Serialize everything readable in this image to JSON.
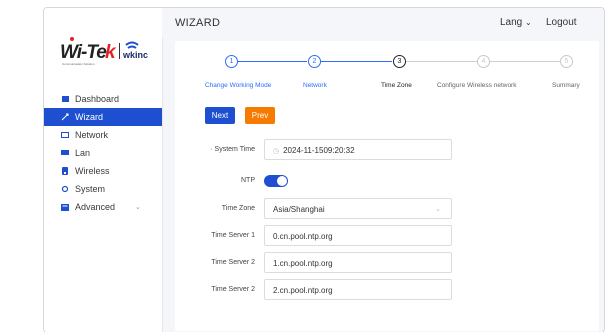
{
  "header": {
    "title": "WIZARD",
    "lang": "Lang",
    "logout": "Logout"
  },
  "brand": {
    "logo1": "Wi-Tek",
    "logo1_sub": "Communication Solution",
    "logo2": "wkinc"
  },
  "sidebar": {
    "items": [
      {
        "label": "Dashboard",
        "icon": "dashboard-icon"
      },
      {
        "label": "Wizard",
        "icon": "wizard-icon",
        "active": true
      },
      {
        "label": "Network",
        "icon": "network-icon"
      },
      {
        "label": "Lan",
        "icon": "lan-icon"
      },
      {
        "label": "Wireless",
        "icon": "wireless-icon"
      },
      {
        "label": "System",
        "icon": "system-icon"
      },
      {
        "label": "Advanced",
        "icon": "advanced-icon"
      }
    ]
  },
  "steps": [
    {
      "num": "1",
      "label": "Change Working Mode",
      "state": "done"
    },
    {
      "num": "2",
      "label": "Network",
      "state": "done"
    },
    {
      "num": "3",
      "label": "Time Zone",
      "state": "current"
    },
    {
      "num": "4",
      "label": "Configure Wireless network",
      "state": "todo"
    },
    {
      "num": "5",
      "label": "Summary",
      "state": "todo"
    }
  ],
  "buttons": {
    "next": "Next",
    "prev": "Prev"
  },
  "form": {
    "system_time_label": "System Time",
    "system_time_value": "2024-11-1509:20:32",
    "ntp_label": "NTP",
    "ntp_enabled": true,
    "time_zone_label": "Time Zone",
    "time_zone_value": "Asia/Shanghai",
    "server1_label": "Time Server 1",
    "server1_value": "0.cn.pool.ntp.org",
    "server2_label": "Time Server 2",
    "server2_value": "1.cn.pool.ntp.org",
    "server3_label": "Time Server 2",
    "server3_value": "2.cn.pool.ntp.org"
  },
  "colors": {
    "accent": "#1f4fd1",
    "step_blue": "#2f6bff",
    "prev_orange": "#f57c00"
  }
}
